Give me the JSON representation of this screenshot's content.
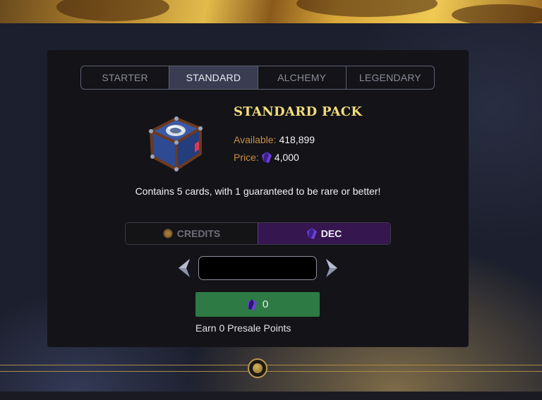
{
  "tabs": [
    {
      "label": "STARTER",
      "active": false
    },
    {
      "label": "STANDARD",
      "active": true
    },
    {
      "label": "ALCHEMY",
      "active": false
    },
    {
      "label": "LEGENDARY",
      "active": false
    }
  ],
  "pack": {
    "title": "STANDARD PACK",
    "available_label": "Available:",
    "available_value": "418,899",
    "price_label": "Price:",
    "price_value": "4,000",
    "description": "Contains 5 cards, with 1 guaranteed to be rare or better!"
  },
  "currency": {
    "credits_label": "CREDITS",
    "dec_label": "DEC",
    "selected": "DEC"
  },
  "quantity": {
    "value": ""
  },
  "buy": {
    "amount": "0"
  },
  "earn_text": "Earn 0 Presale Points",
  "icons": {
    "chest": "treasure-chest-icon",
    "dec": "dec-crystal-icon",
    "credits": "credits-coin-icon",
    "prev": "chevron-left-icon",
    "next": "chevron-right-icon"
  },
  "colors": {
    "accent_gold": "#f2dc7a",
    "label_orange": "#c98f45",
    "dec_purple": "#36164f",
    "buy_green": "#2d7a44"
  }
}
